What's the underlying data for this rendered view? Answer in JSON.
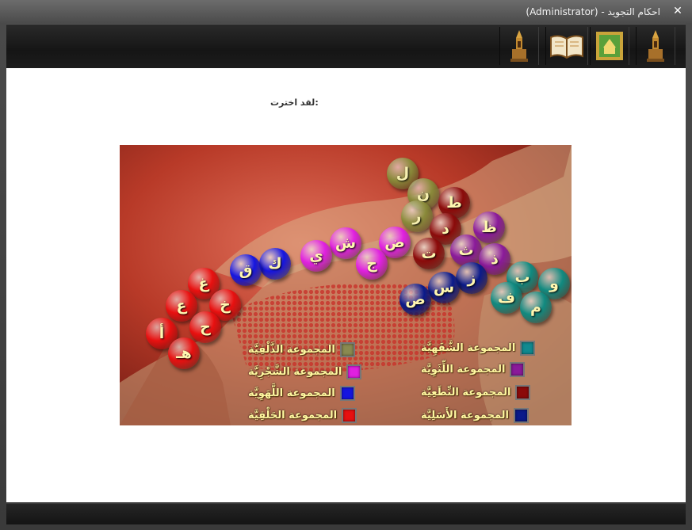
{
  "window": {
    "title": "احكام التجويد - (Administrator)",
    "close_glyph": "✕"
  },
  "toolbar": {
    "icons": [
      "mosque-icon",
      "quran-book-icon",
      "green-frame-icon",
      "mosque-icon"
    ]
  },
  "content": {
    "heading": ":لقد اخترت"
  },
  "letters": [
    {
      "char": "ل",
      "group": "olive"
    },
    {
      "char": "ن",
      "group": "olive"
    },
    {
      "char": "ر",
      "group": "olive"
    },
    {
      "char": "ط",
      "group": "darkred"
    },
    {
      "char": "د",
      "group": "darkred"
    },
    {
      "char": "ت",
      "group": "darkred"
    },
    {
      "char": "ظ",
      "group": "purple"
    },
    {
      "char": "ث",
      "group": "purple"
    },
    {
      "char": "ذ",
      "group": "purple"
    },
    {
      "char": "ض",
      "group": "magenta"
    },
    {
      "char": "ش",
      "group": "magenta"
    },
    {
      "char": "ج",
      "group": "magenta"
    },
    {
      "char": "ي",
      "group": "magenta"
    },
    {
      "char": "ك",
      "group": "blue"
    },
    {
      "char": "ق",
      "group": "blue"
    },
    {
      "char": "غ",
      "group": "red"
    },
    {
      "char": "خ",
      "group": "red"
    },
    {
      "char": "ع",
      "group": "red"
    },
    {
      "char": "ح",
      "group": "red"
    },
    {
      "char": "أ",
      "group": "red"
    },
    {
      "char": "هـ",
      "group": "red"
    },
    {
      "char": "ز",
      "group": "navy"
    },
    {
      "char": "س",
      "group": "navy"
    },
    {
      "char": "ص",
      "group": "navy"
    },
    {
      "char": "ب",
      "group": "teal"
    },
    {
      "char": "و",
      "group": "teal"
    },
    {
      "char": "ف",
      "group": "teal"
    },
    {
      "char": "م",
      "group": "teal"
    }
  ],
  "group_colors": {
    "olive": "#8a8a3a",
    "darkred": "#8b0a0a",
    "purple": "#8a1a9a",
    "magenta": "#e020e0",
    "blue": "#1515e0",
    "red": "#e81010",
    "navy": "#0a1a8a",
    "teal": "#108a80"
  },
  "legend": [
    {
      "label": "المجموعة الذَّلْقِيَّة",
      "color": "#8a8a50"
    },
    {
      "label": "المجموعة الشَّجْرِيَّة",
      "color": "#e020e0"
    },
    {
      "label": "المجموعة اللَّهَوِيَّة",
      "color": "#1515e0"
    },
    {
      "label": "المجموعة الحَلْقِيَّة",
      "color": "#e81010"
    },
    {
      "label": "المجموعة الشَّفَهِيَّة",
      "color": "#108a90"
    },
    {
      "label": "المجموعة اللِّثَوِيَّة",
      "color": "#8a1a9a"
    },
    {
      "label": "المجموعة النِّطَعِيَّة",
      "color": "#8b0a0a"
    },
    {
      "label": "المجموعة الأَسَلِيَّة",
      "color": "#0a1a8a"
    }
  ]
}
